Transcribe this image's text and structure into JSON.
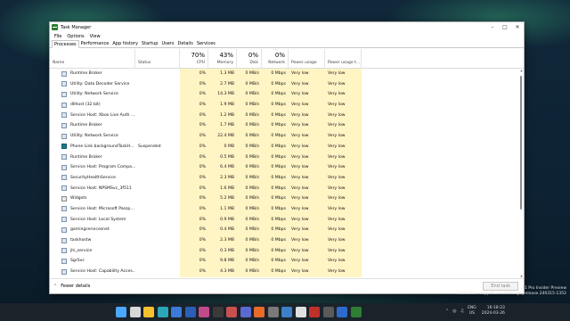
{
  "window": {
    "title": "Task Manager"
  },
  "menu": [
    "File",
    "Options",
    "View"
  ],
  "tabs": [
    "Processes",
    "Performance",
    "App history",
    "Startup",
    "Users",
    "Details",
    "Services"
  ],
  "columns": {
    "name": "Name",
    "status": "Status",
    "cpu": {
      "percent": "70%",
      "label": "CPU"
    },
    "memory": {
      "percent": "43%",
      "label": "Memory"
    },
    "disk": {
      "percent": "0%",
      "label": "Disk"
    },
    "network": {
      "percent": "0%",
      "label": "Network"
    },
    "power": "Power usage",
    "power_trend": "Power usage t..."
  },
  "processes": [
    {
      "icon": "box-icon",
      "name": "Runtime Broker",
      "status": "",
      "cpu": "0%",
      "memory": "1.3 MB",
      "disk": "0 MB/s",
      "network": "0 Mbps",
      "power": "Very low",
      "power_trend": "Very low"
    },
    {
      "icon": "gear-box-icon",
      "name": "Utility: Data Decoder Service",
      "status": "",
      "cpu": "0%",
      "memory": "2.7 MB",
      "disk": "0 MB/s",
      "network": "0 Mbps",
      "power": "Very low",
      "power_trend": "Very low"
    },
    {
      "icon": "gear-box-icon",
      "name": "Utility: Network Service",
      "status": "",
      "cpu": "0%",
      "memory": "14.3 MB",
      "disk": "0 MB/s",
      "network": "0 Mbps",
      "power": "Very low",
      "power_trend": "Very low"
    },
    {
      "icon": "box-icon",
      "name": "dllhost (32 bit)",
      "status": "",
      "cpu": "0%",
      "memory": "1.9 MB",
      "disk": "0 MB/s",
      "network": "0 Mbps",
      "power": "Very low",
      "power_trend": "Very low"
    },
    {
      "icon": "gear-box-icon",
      "name": "Service Host: Xbox Live Auth ...",
      "status": "",
      "cpu": "0%",
      "memory": "1.2 MB",
      "disk": "0 MB/s",
      "network": "0 Mbps",
      "power": "Very low",
      "power_trend": "Very low"
    },
    {
      "icon": "box-icon",
      "name": "Runtime Broker",
      "status": "",
      "cpu": "0%",
      "memory": "1.7 MB",
      "disk": "0 MB/s",
      "network": "0 Mbps",
      "power": "Very low",
      "power_trend": "Very low"
    },
    {
      "icon": "gear-box-icon",
      "name": "Utility: Network Service",
      "status": "",
      "cpu": "0%",
      "memory": "22.4 MB",
      "disk": "0 MB/s",
      "network": "0 Mbps",
      "power": "Very low",
      "power_trend": "Very low"
    },
    {
      "icon": "phone-link-icon",
      "name": "Phone Link backgroundTaskH...",
      "status": "Suspended",
      "cpu": "0%",
      "memory": "0 MB",
      "disk": "0 MB/s",
      "network": "0 Mbps",
      "power": "Very low",
      "power_trend": "Very low"
    },
    {
      "icon": "box-icon",
      "name": "Runtime Broker",
      "status": "",
      "cpu": "0%",
      "memory": "0.5 MB",
      "disk": "0 MB/s",
      "network": "0 Mbps",
      "power": "Very low",
      "power_trend": "Very low"
    },
    {
      "icon": "gear-box-icon",
      "name": "Service Host: Program Compa...",
      "status": "",
      "cpu": "0%",
      "memory": "6.4 MB",
      "disk": "0 MB/s",
      "network": "0 Mbps",
      "power": "Very low",
      "power_trend": "Very low"
    },
    {
      "icon": "box-icon",
      "name": "SecurityHealthService",
      "status": "",
      "cpu": "0%",
      "memory": "2.3 MB",
      "disk": "0 MB/s",
      "network": "0 Mbps",
      "power": "Very low",
      "power_trend": "Very low"
    },
    {
      "icon": "gear-box-icon",
      "name": "Service Host: NPSMSvc_3f511",
      "status": "",
      "cpu": "0%",
      "memory": "1.6 MB",
      "disk": "0 MB/s",
      "network": "0 Mbps",
      "power": "Very low",
      "power_trend": "Very low"
    },
    {
      "icon": "widgets-icon",
      "name": "Widgets",
      "status": "",
      "cpu": "0%",
      "memory": "5.2 MB",
      "disk": "0 MB/s",
      "network": "0 Mbps",
      "power": "Very low",
      "power_trend": "Very low"
    },
    {
      "icon": "gear-box-icon",
      "name": "Service Host: Microsoft Passp...",
      "status": "",
      "cpu": "0%",
      "memory": "1.1 MB",
      "disk": "0 MB/s",
      "network": "0 Mbps",
      "power": "Very low",
      "power_trend": "Very low"
    },
    {
      "icon": "gear-box-icon",
      "name": "Service Host: Local System",
      "status": "",
      "cpu": "0%",
      "memory": "0.9 MB",
      "disk": "0 MB/s",
      "network": "0 Mbps",
      "power": "Very low",
      "power_trend": "Very low"
    },
    {
      "icon": "box-icon",
      "name": "gamingservicesnet",
      "status": "",
      "cpu": "0%",
      "memory": "0.4 MB",
      "disk": "0 MB/s",
      "network": "0 Mbps",
      "power": "Very low",
      "power_trend": "Very low"
    },
    {
      "icon": "box-icon",
      "name": "taskhostw",
      "status": "",
      "cpu": "0%",
      "memory": "2.3 MB",
      "disk": "0 MB/s",
      "network": "0 Mbps",
      "power": "Very low",
      "power_trend": "Very low"
    },
    {
      "icon": "box-icon",
      "name": "jhi_service",
      "status": "",
      "cpu": "0%",
      "memory": "0.3 MB",
      "disk": "0 MB/s",
      "network": "0 Mbps",
      "power": "Very low",
      "power_trend": "Very low"
    },
    {
      "icon": "box-icon",
      "name": "SgrSvc",
      "status": "",
      "cpu": "0%",
      "memory": "9.8 MB",
      "disk": "0 MB/s",
      "network": "0 Mbps",
      "power": "Very low",
      "power_trend": "Very low"
    },
    {
      "icon": "gear-box-icon",
      "name": "Service Host: Capability Acces...",
      "status": "",
      "cpu": "0%",
      "memory": "4.3 MB",
      "disk": "0 MB/s",
      "network": "0 Mbps",
      "power": "Very low",
      "power_trend": "Very low"
    }
  ],
  "footer": {
    "fewer_details": "Fewer details",
    "end_task": "End task"
  },
  "watermark": {
    "line1": "11 Pro Insider Preview",
    "line2": "Evaluation copy. Build 26085.ge_release.240315-1352"
  },
  "taskbar": {
    "lang_line1": "ENG",
    "lang_line2": "US",
    "time": "16:18:23",
    "date": "2024-03-26",
    "apps": [
      {
        "name": "windows-start-icon",
        "color": "#4aa8ff"
      },
      {
        "name": "search-icon",
        "color": "#d8d8d8"
      },
      {
        "name": "file-explorer-icon",
        "color": "#f2c230"
      },
      {
        "name": "edge-icon",
        "color": "#2aa8b8"
      },
      {
        "name": "edge-beta-icon",
        "color": "#3b7ad8"
      },
      {
        "name": "word-icon",
        "color": "#2b5eb8"
      },
      {
        "name": "app-icon",
        "color": "#c04a8a"
      },
      {
        "name": "terminal-icon",
        "color": "#3a3a3a"
      },
      {
        "name": "store-icon",
        "color": "#c85050"
      },
      {
        "name": "chat-icon",
        "color": "#5a6ad0"
      },
      {
        "name": "firefox-icon",
        "color": "#e76b2b"
      },
      {
        "name": "settings-icon",
        "color": "#7a7a7a"
      },
      {
        "name": "photos-icon",
        "color": "#3c80c8"
      },
      {
        "name": "app-icon-2",
        "color": "#e0e0e0"
      },
      {
        "name": "app-icon-3",
        "color": "#c0302a"
      },
      {
        "name": "app-icon-4",
        "color": "#5a5a5a"
      },
      {
        "name": "app-icon-5",
        "color": "#2d6acb"
      },
      {
        "name": "task-manager-icon",
        "color": "#2e7d32"
      }
    ]
  }
}
